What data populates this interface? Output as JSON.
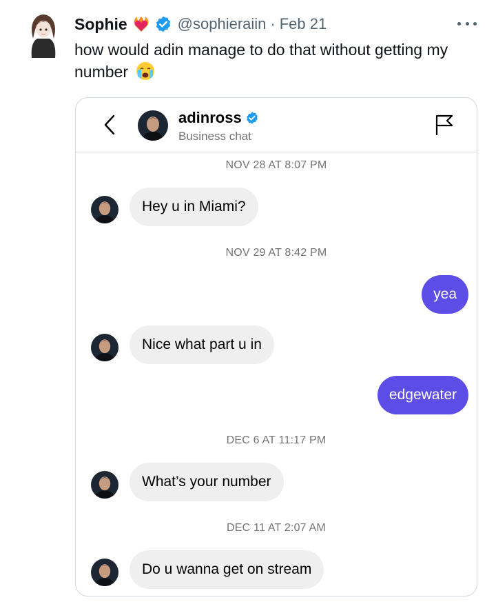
{
  "tweet": {
    "author_name": "Sophie",
    "handle": "@sophieraiin",
    "separator": "·",
    "date": "Feb 21",
    "text": "how would adin manage to do that without getting my number",
    "emoji_icon": "loudly-crying-face-icon",
    "name_emoji_icon": "heart-on-fire-icon",
    "verified_color": "#1d9bf0"
  },
  "chat": {
    "username": "adinross",
    "subtitle": "Business chat",
    "accent_color": "#5c4de6",
    "incoming_bg": "#efefef",
    "timestamps": [
      "NOV 28 AT 8:07 PM",
      "NOV 29 AT 8:42 PM",
      "DEC 6 AT 11:17 PM",
      "DEC 11 AT 2:07 AM"
    ],
    "messages": [
      {
        "from": "them",
        "text": "Hey u in Miami?"
      },
      {
        "from": "me",
        "text": "yea"
      },
      {
        "from": "them",
        "text": "Nice what part u in"
      },
      {
        "from": "me",
        "text": "edgewater"
      },
      {
        "from": "them",
        "text": "What’s your number"
      },
      {
        "from": "them",
        "text": "Do u wanna get on stream"
      }
    ]
  }
}
